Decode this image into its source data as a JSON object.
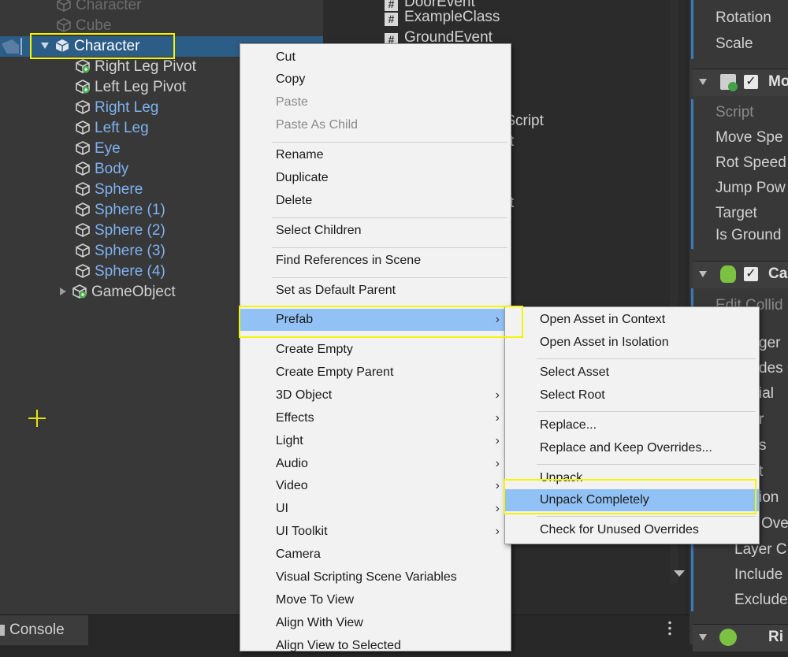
{
  "hierarchy": {
    "items": [
      {
        "label": "Character",
        "style": "dim"
      },
      {
        "label": "Cube",
        "style": "dim"
      },
      {
        "label": "Character",
        "style": "selected"
      },
      {
        "label": "Right Leg Pivot",
        "style": "prefab"
      },
      {
        "label": "Left Leg Pivot",
        "style": "prefab"
      },
      {
        "label": "Right Leg",
        "style": "blue"
      },
      {
        "label": "Left Leg",
        "style": "blue"
      },
      {
        "label": "Eye",
        "style": "blue"
      },
      {
        "label": "Body",
        "style": "blue"
      },
      {
        "label": "Sphere",
        "style": "blue"
      },
      {
        "label": "Sphere (1)",
        "style": "blue"
      },
      {
        "label": "Sphere (2)",
        "style": "blue"
      },
      {
        "label": "Sphere (3)",
        "style": "blue"
      },
      {
        "label": "Sphere (4)",
        "style": "blue"
      },
      {
        "label": "GameObject",
        "style": "prefab"
      }
    ]
  },
  "project": {
    "items": [
      "DoorEvent",
      "ExampleClass",
      "GroundEvent"
    ],
    "partials": [
      "rScript",
      "t",
      "t"
    ]
  },
  "inspector": {
    "transform_rows": [
      "Rotation",
      "Scale"
    ],
    "component1": {
      "name": "Mo",
      "fields": [
        "Script",
        "Move Spe",
        "Rot Speed",
        "Jump Pow",
        "Target",
        "Is Ground"
      ]
    },
    "component2": {
      "name": "Ca",
      "fields": [
        "Edit Collid",
        "ger",
        "des C",
        "ial",
        "r",
        "s",
        "t",
        "ion",
        "Ove",
        "Layer C",
        "Include",
        "Exclude"
      ]
    },
    "component3": {
      "name": "Ri"
    }
  },
  "context_menu": {
    "items": [
      {
        "label": "Cut",
        "enabled": true
      },
      {
        "label": "Copy",
        "enabled": true
      },
      {
        "label": "Paste",
        "enabled": false
      },
      {
        "label": "Paste As Child",
        "enabled": false
      },
      {
        "label": "Rename",
        "enabled": true
      },
      {
        "label": "Duplicate",
        "enabled": true
      },
      {
        "label": "Delete",
        "enabled": true
      },
      {
        "label": "Select Children",
        "enabled": true
      },
      {
        "label": "Find References in Scene",
        "enabled": true
      },
      {
        "label": "Set as Default Parent",
        "enabled": true
      },
      {
        "label": "Prefab",
        "enabled": true,
        "submenu": true,
        "selected": true
      },
      {
        "label": "Create Empty",
        "enabled": true
      },
      {
        "label": "Create Empty Parent",
        "enabled": true
      },
      {
        "label": "3D Object",
        "enabled": true,
        "submenu": true
      },
      {
        "label": "Effects",
        "enabled": true,
        "submenu": true
      },
      {
        "label": "Light",
        "enabled": true,
        "submenu": true
      },
      {
        "label": "Audio",
        "enabled": true,
        "submenu": true
      },
      {
        "label": "Video",
        "enabled": true,
        "submenu": true
      },
      {
        "label": "UI",
        "enabled": true,
        "submenu": true
      },
      {
        "label": "UI Toolkit",
        "enabled": true,
        "submenu": true
      },
      {
        "label": "Camera",
        "enabled": true
      },
      {
        "label": "Visual Scripting Scene Variables",
        "enabled": true
      },
      {
        "label": "Move To View",
        "enabled": true
      },
      {
        "label": "Align With View",
        "enabled": true
      },
      {
        "label": "Align View to Selected",
        "enabled": true
      }
    ],
    "arrow_glyph": "›"
  },
  "prefab_submenu": {
    "items": [
      {
        "label": "Open Asset in Context"
      },
      {
        "label": "Open Asset in Isolation"
      },
      {
        "label": "Select Asset"
      },
      {
        "label": "Select Root"
      },
      {
        "label": "Replace..."
      },
      {
        "label": "Replace and Keep Overrides..."
      },
      {
        "label": "Unpack"
      },
      {
        "label": "Unpack Completely",
        "selected": true
      },
      {
        "label": "Check for Unused Overrides"
      }
    ]
  },
  "bottom": {
    "console_tab": "Console"
  },
  "colors": {
    "highlight": "#f5f500",
    "selection": "#2c5d87",
    "menu_selected": "#92c2f5"
  }
}
